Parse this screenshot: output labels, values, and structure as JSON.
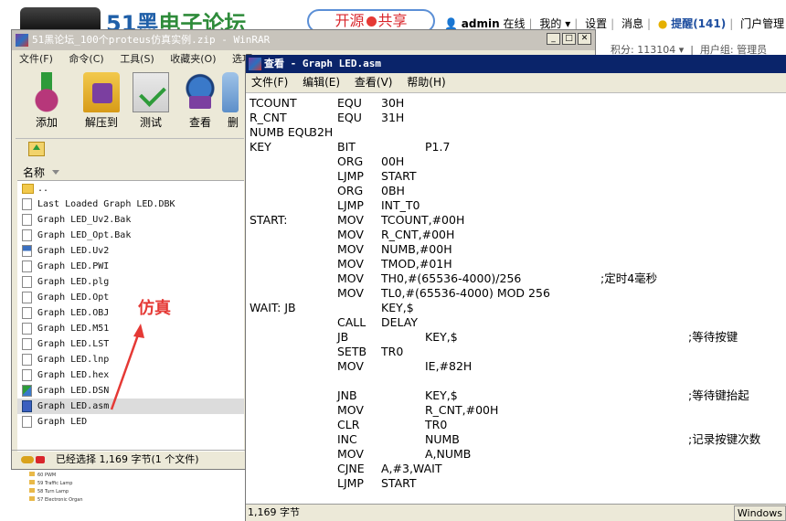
{
  "forum": {
    "logo_num": "51",
    "logo_cn": "黑",
    "logo_green": "电子论坛",
    "pill_left": "开源",
    "pill_right": "共享",
    "user": "admin",
    "online": "在线",
    "my": "我的",
    "settings": "设置",
    "messages": "消息",
    "reminder": "提醒(141)",
    "portal": "门户管理",
    "points": "积分: 113104",
    "usergroup": "用户组: 管理员",
    "sidelist": [
      "60 PWM",
      "59 Traffic Lamp",
      "58 Turn Lamp",
      "57 Electronic Organ"
    ]
  },
  "winrar": {
    "title": "51黑论坛_100个proteus仿真实例.zip - WinRAR",
    "menu": [
      "文件(F)",
      "命令(C)",
      "工具(S)",
      "收藏夹(O)",
      "选项"
    ],
    "toolbar": [
      {
        "label": "添加",
        "icon": "add-archive-icon"
      },
      {
        "label": "解压到",
        "icon": "extract-icon"
      },
      {
        "label": "测试",
        "icon": "test-icon"
      },
      {
        "label": "查看",
        "icon": "view-icon"
      },
      {
        "label": "删",
        "icon": "delete-icon"
      }
    ],
    "column_name": "名称",
    "files": [
      {
        "name": "..",
        "type": "folder"
      },
      {
        "name": "Last Loaded Graph LED.DBK",
        "type": "file"
      },
      {
        "name": "Graph LED_Uv2.Bak",
        "type": "file"
      },
      {
        "name": "Graph LED_Opt.Bak",
        "type": "file"
      },
      {
        "name": "Graph LED.Uv2",
        "type": "uv"
      },
      {
        "name": "Graph LED.PWI",
        "type": "file"
      },
      {
        "name": "Graph LED.plg",
        "type": "file"
      },
      {
        "name": "Graph LED.Opt",
        "type": "file"
      },
      {
        "name": "Graph LED.OBJ",
        "type": "file"
      },
      {
        "name": "Graph LED.M51",
        "type": "file"
      },
      {
        "name": "Graph LED.LST",
        "type": "file"
      },
      {
        "name": "Graph LED.lnp",
        "type": "file"
      },
      {
        "name": "Graph LED.hex",
        "type": "file"
      },
      {
        "name": "Graph LED.DSN",
        "type": "dsn"
      },
      {
        "name": "Graph LED.asm",
        "type": "asm",
        "selected": true
      },
      {
        "name": "Graph LED",
        "type": "file"
      }
    ],
    "status": "已经选择 1,169 字节(1 个文件)"
  },
  "annotation": "仿真",
  "viewer": {
    "title": "查看 - Graph LED.asm",
    "menu": [
      "文件(F)",
      "编辑(E)",
      "查看(V)",
      "帮助(H)"
    ],
    "code": [
      {
        "label": "TCOUNT",
        "op": "EQU",
        "a1": "30H",
        "a2": "",
        "cm": ""
      },
      {
        "label": "R_CNT",
        "op": "EQU",
        "a1": "31H",
        "a2": "",
        "cm": ""
      },
      {
        "label": "NUMB EQU",
        "op": "",
        "a1": "",
        "a2": "",
        "cm": "",
        "x": "32H"
      },
      {
        "label": "KEY",
        "op": "BIT",
        "a1": "",
        "a2": "P1.7",
        "cm": ""
      },
      {
        "label": "",
        "op": "ORG",
        "a1": "00H",
        "a2": "",
        "cm": ""
      },
      {
        "label": "",
        "op": "LJMP",
        "a1": "START",
        "a2": "",
        "cm": ""
      },
      {
        "label": "",
        "op": "ORG",
        "a1": "0BH",
        "a2": "",
        "cm": ""
      },
      {
        "label": "",
        "op": "LJMP",
        "a1": "INT_T0",
        "a2": "",
        "cm": ""
      },
      {
        "label": "START:",
        "op": "MOV",
        "a1": "TCOUNT,#00H",
        "a2": "",
        "cm": ""
      },
      {
        "label": "",
        "op": "MOV",
        "a1": "R_CNT,#00H",
        "a2": "",
        "cm": ""
      },
      {
        "label": "",
        "op": "MOV",
        "a1": "NUMB,#00H",
        "a2": "",
        "cm": ""
      },
      {
        "label": "",
        "op": "MOV",
        "a1": "TMOD,#01H",
        "a2": "",
        "cm": ""
      },
      {
        "label": "",
        "op": "MOV",
        "a1": "TH0,#(65536-4000)/256",
        "a2": "",
        "cm": ";定时4毫秒",
        "cmpos": "mid"
      },
      {
        "label": "",
        "op": "MOV",
        "a1": "TL0,#(65536-4000) MOD 256",
        "a2": "",
        "cm": ""
      },
      {
        "label": "WAIT:  JB",
        "op": "",
        "a1": "KEY,$",
        "a2": "",
        "cm": ""
      },
      {
        "label": "",
        "op": "CALL",
        "a1": "DELAY",
        "a2": "",
        "cm": ""
      },
      {
        "label": "",
        "op": "JB",
        "a1": "",
        "a2": "KEY,$",
        "cm": ";等待按键"
      },
      {
        "label": "",
        "op": "SETB",
        "a1": "TR0",
        "a2": "",
        "cm": ""
      },
      {
        "label": "",
        "op": "MOV",
        "a1": "",
        "a2": "IE,#82H",
        "cm": ""
      },
      {
        "label": "",
        "op": "",
        "a1": "",
        "a2": "",
        "cm": ""
      },
      {
        "label": "",
        "op": "JNB",
        "a1": "",
        "a2": "KEY,$",
        "cm": ";等待键抬起"
      },
      {
        "label": "",
        "op": "MOV",
        "a1": "",
        "a2": "R_CNT,#00H",
        "cm": ""
      },
      {
        "label": "",
        "op": "CLR",
        "a1": "",
        "a2": "TR0",
        "cm": ""
      },
      {
        "label": "",
        "op": "INC",
        "a1": "",
        "a2": "NUMB",
        "cm": ";记录按键次数"
      },
      {
        "label": "",
        "op": "MOV",
        "a1": "",
        "a2": "A,NUMB",
        "cm": ""
      },
      {
        "label": "",
        "op": "CJNE",
        "a1": "A,#3,WAIT",
        "a2": "",
        "cm": ""
      },
      {
        "label": "",
        "op": "LJMP",
        "a1": "START",
        "a2": "",
        "cm": ""
      }
    ],
    "status": "1,169 字节",
    "encoding": "Windows"
  }
}
